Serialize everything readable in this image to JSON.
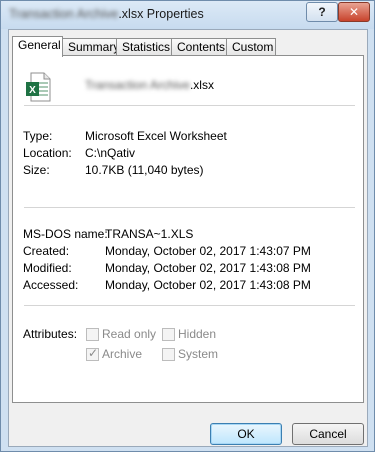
{
  "window": {
    "title_blurred": "Transaction Archive",
    "title_suffix": ".xlsx Properties",
    "help_label": "?",
    "close_label": "✕"
  },
  "tabs": [
    {
      "label": "General",
      "active": true
    },
    {
      "label": "Summary",
      "active": false
    },
    {
      "label": "Statistics",
      "active": false
    },
    {
      "label": "Contents",
      "active": false
    },
    {
      "label": "Custom",
      "active": false
    }
  ],
  "file": {
    "icon": "excel-file-icon",
    "name_blurred": "Transaction Archive",
    "name_suffix": ".xlsx"
  },
  "info": {
    "type_label": "Type:",
    "type_value": "Microsoft Excel Worksheet",
    "location_label": "Location:",
    "location_value": "C:\\nQativ",
    "size_label": "Size:",
    "size_value": "10.7KB (11,040 bytes)"
  },
  "dates": {
    "msdos_label": "MS-DOS name:",
    "msdos_value": "TRANSA~1.XLS",
    "created_label": "Created:",
    "created_value": "Monday, October 02, 2017 1:43:07 PM",
    "modified_label": "Modified:",
    "modified_value": "Monday, October 02, 2017 1:43:08 PM",
    "accessed_label": "Accessed:",
    "accessed_value": "Monday, October 02, 2017 1:43:08 PM"
  },
  "attributes": {
    "label": "Attributes:",
    "read_only": {
      "label": "Read only",
      "checked": false
    },
    "hidden": {
      "label": "Hidden",
      "checked": false
    },
    "archive": {
      "label": "Archive",
      "checked": true
    },
    "system": {
      "label": "System",
      "checked": false
    }
  },
  "buttons": {
    "ok": "OK",
    "cancel": "Cancel"
  },
  "colors": {
    "excel_green": "#1f7244",
    "frame": "#cfe0f1"
  }
}
